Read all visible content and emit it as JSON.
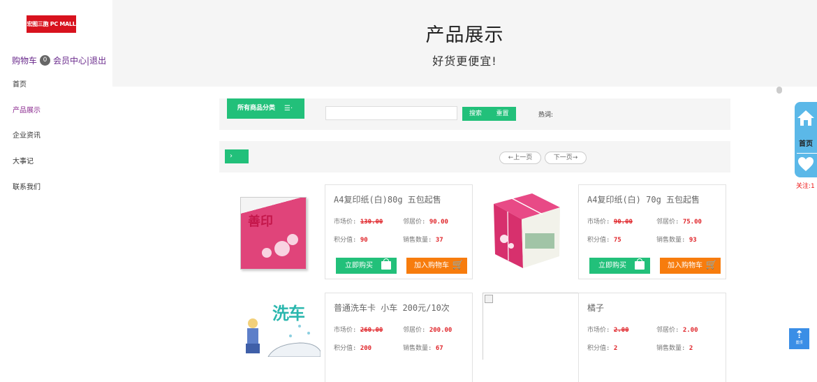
{
  "logo": {
    "text": "宏图三胞 PC MALL"
  },
  "user_links": {
    "cart": "购物车",
    "cart_count": "0",
    "member": "会员中心",
    "separator": "|",
    "logout": "退出"
  },
  "nav": {
    "items": [
      {
        "label": "首页"
      },
      {
        "label": "产品展示"
      },
      {
        "label": "企业资讯"
      },
      {
        "label": "大事记"
      },
      {
        "label": "联系我们"
      }
    ]
  },
  "banner": {
    "title": "产品展示",
    "subtitle": "好货更便宜!"
  },
  "search": {
    "category_label": "所有商品分类",
    "category_icon": "☰·",
    "input_value": "",
    "search_label": "搜索",
    "reset_label": "重置",
    "hotword_label": "热词:"
  },
  "pager": {
    "toggle_icon": "›",
    "prev_label": "←上一页",
    "next_label": "下一页→"
  },
  "products": [
    {
      "name": "A4复印纸(白)80g 五包起售",
      "market_label": "市场价:",
      "market_price": "130.00",
      "neighbor_label": "邻居价:",
      "neighbor_price": "90.00",
      "points_label": "积分值:",
      "points": "90",
      "sales_label": "销售数量:",
      "sales": "37",
      "buy_label": "立即购买",
      "cart_label": "加入购物车",
      "image": "paper-flat"
    },
    {
      "name": "A4复印纸(白) 70g 五包起售",
      "market_label": "市场价:",
      "market_price": "90.00",
      "neighbor_label": "邻居价:",
      "neighbor_price": "75.00",
      "points_label": "积分值:",
      "points": "75",
      "sales_label": "销售数量:",
      "sales": "93",
      "buy_label": "立即购买",
      "cart_label": "加入购物车",
      "image": "paper-carton"
    },
    {
      "name": "普通洗车卡 小车 200元/10次",
      "market_label": "市场价:",
      "market_price": "260.00",
      "neighbor_label": "邻居价:",
      "neighbor_price": "200.00",
      "points_label": "积分值:",
      "points": "200",
      "sales_label": "销售数量:",
      "sales": "67",
      "image_text": "洗车",
      "image": "car-wash"
    },
    {
      "name": "橘子",
      "market_label": "市场价:",
      "market_price": "2.00",
      "neighbor_label": "邻居价:",
      "neighbor_price": "2.00",
      "points_label": "积分值:",
      "points": "2",
      "sales_label": "销售数量:",
      "sales": "2",
      "image": "broken-image"
    }
  ],
  "float_bar": {
    "home_label": "首页",
    "follow_label": "关注:1"
  },
  "back_top": {
    "label": "置顶"
  },
  "colors": {
    "green": "#22c07a",
    "orange": "#f77c0d",
    "price_red": "#e0262b",
    "purple": "#6a2a8c",
    "float_blue": "#5bb8e8"
  }
}
